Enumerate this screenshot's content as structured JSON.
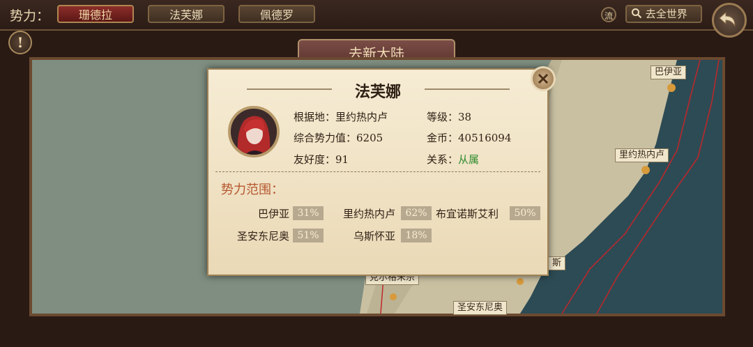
{
  "topbar": {
    "faction_label": "势力：",
    "factions": [
      "珊德拉",
      "法芙娜",
      "佩德罗"
    ],
    "flow_icon_label": "流",
    "world_button": "去全世界"
  },
  "map": {
    "header": "去新大陆",
    "labels": {
      "bayia": "巴伊亚",
      "rio": "里约热内卢",
      "bottom_left": "克尔格朱宗",
      "bottom_right": "圣安东尼奥",
      "partial": "斯"
    }
  },
  "dialog": {
    "title": "法芙娜",
    "base_label": "根据地：",
    "base_value": "里约热内卢",
    "level_label": "等级：",
    "level_value": "38",
    "power_label": "综合势力值：",
    "power_value": "6205",
    "gold_label": "金币：",
    "gold_value": "40516094",
    "friend_label": "友好度：",
    "friend_value": "91",
    "relation_label": "关系：",
    "relation_value": "从属",
    "section_title": "势力范围：",
    "regions": [
      {
        "name": "巴伊亚",
        "pct": "31%"
      },
      {
        "name": "里约热内卢",
        "pct": "62%"
      },
      {
        "name": "布宜诺斯艾利",
        "pct": "50%"
      },
      {
        "name": "圣安东尼奥",
        "pct": "51%"
      },
      {
        "name": "乌斯怀亚",
        "pct": "18%"
      }
    ]
  },
  "icons": {
    "search": "search-icon",
    "back": "back-arrow-icon",
    "alert": "exclamation-icon",
    "close": "close-icon"
  }
}
